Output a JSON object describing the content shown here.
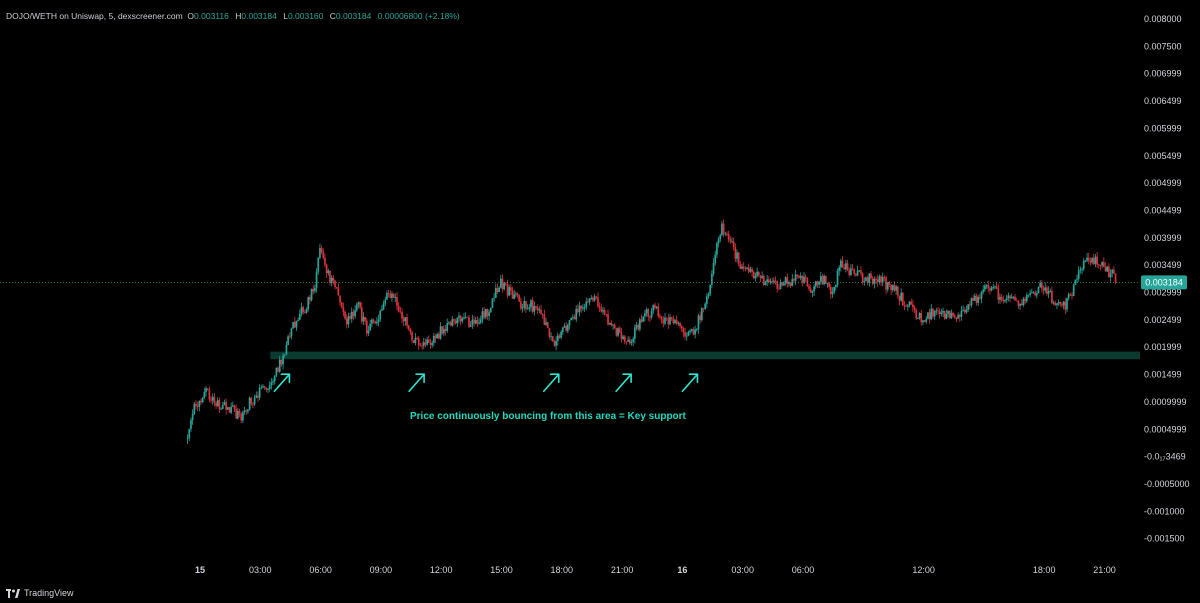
{
  "legend": {
    "symbol": "DOJO/WETH on Uniswap, 5, dexscreener.com",
    "open_label": "O",
    "open": "0.003116",
    "high_label": "H",
    "high": "0.003184",
    "low_label": "L",
    "low": "0.003160",
    "close_label": "C",
    "close": "0.003184",
    "change": "0.00006800 (+2.18%)"
  },
  "price_tag": "0.003184",
  "brand": "TradingView",
  "annotation": "Price continuously bouncing from this area = Key support",
  "colors": {
    "background": "#000000",
    "up": "#26a69a",
    "down": "#e0313b",
    "support_zone": "#0b3a30",
    "price_tag_bg": "#26a69a",
    "annotation": "#21d9c0",
    "arrow": "#2ee6cf"
  },
  "chart_data": {
    "type": "candlestick",
    "y_tick_labels": [
      "0.008000",
      "0.007500",
      "0.006999",
      "0.006499",
      "0.005999",
      "0.005499",
      "0.004999",
      "0.004499",
      "0.003999",
      "0.003499",
      "0.002999",
      "0.002499",
      "0.001999",
      "0.001499",
      "0.0009999",
      "0.0004999",
      "-0.0₁₇3469",
      "-0.0005000",
      "-0.001000",
      "-0.001500"
    ],
    "y_tick_values": [
      0.008,
      0.0075,
      0.007,
      0.0065,
      0.006,
      0.0055,
      0.005,
      0.0045,
      0.004,
      0.0035,
      0.003,
      0.0025,
      0.002,
      0.0015,
      0.001,
      0.0005,
      0.0,
      -0.0005,
      -0.001,
      -0.0015
    ],
    "ylim": [
      -0.0019,
      0.0081
    ],
    "x_tick_labels": [
      "15",
      "03:00",
      "06:00",
      "09:00",
      "12:00",
      "15:00",
      "18:00",
      "21:00",
      "16",
      "03:00",
      "06:00",
      "12:00",
      "18:00",
      "21:00"
    ],
    "x_tick_hours": [
      0,
      3,
      6,
      9,
      12,
      15,
      18,
      21,
      24,
      27,
      30,
      36,
      42,
      45
    ],
    "bold_x_ticks": [
      "15",
      "16"
    ],
    "time_range_hours": [
      -1.3,
      47.0
    ],
    "current_price": 0.003184,
    "support_zone": [
      0.00178,
      0.00192
    ],
    "support_zone_hours": [
      3.5,
      47.0
    ],
    "bounce_points_hours": [
      4.2,
      10.9,
      17.6,
      21.2,
      24.5
    ],
    "price_path": [
      [
        -0.7,
        0.00032
      ],
      [
        -0.3,
        0.00085
      ],
      [
        0.3,
        0.00115
      ],
      [
        0.7,
        0.001
      ],
      [
        1.5,
        0.0009
      ],
      [
        2.0,
        0.0007
      ],
      [
        2.6,
        0.00105
      ],
      [
        3.3,
        0.00125
      ],
      [
        3.8,
        0.0016
      ],
      [
        4.2,
        0.0019
      ],
      [
        4.6,
        0.0024
      ],
      [
        5.2,
        0.0027
      ],
      [
        5.7,
        0.0031
      ],
      [
        6.0,
        0.0038
      ],
      [
        6.4,
        0.0033
      ],
      [
        6.8,
        0.003
      ],
      [
        7.3,
        0.0024
      ],
      [
        7.8,
        0.0028
      ],
      [
        8.3,
        0.0023
      ],
      [
        8.8,
        0.0025
      ],
      [
        9.3,
        0.003
      ],
      [
        9.8,
        0.0028
      ],
      [
        10.4,
        0.0023
      ],
      [
        10.9,
        0.002
      ],
      [
        11.5,
        0.0021
      ],
      [
        12.0,
        0.0023
      ],
      [
        12.6,
        0.0025
      ],
      [
        13.2,
        0.00245
      ],
      [
        13.8,
        0.0025
      ],
      [
        14.4,
        0.0027
      ],
      [
        14.9,
        0.0032
      ],
      [
        15.4,
        0.003
      ],
      [
        15.9,
        0.0028
      ],
      [
        16.4,
        0.0028
      ],
      [
        16.9,
        0.0026
      ],
      [
        17.6,
        0.0021
      ],
      [
        18.1,
        0.0023
      ],
      [
        18.6,
        0.00255
      ],
      [
        19.1,
        0.00275
      ],
      [
        19.7,
        0.0029
      ],
      [
        20.2,
        0.0025
      ],
      [
        20.7,
        0.0023
      ],
      [
        21.2,
        0.002
      ],
      [
        21.7,
        0.0023
      ],
      [
        22.2,
        0.0026
      ],
      [
        22.7,
        0.0027
      ],
      [
        23.2,
        0.00245
      ],
      [
        23.7,
        0.0025
      ],
      [
        24.2,
        0.00215
      ],
      [
        24.7,
        0.0024
      ],
      [
        25.2,
        0.00285
      ],
      [
        25.6,
        0.0037
      ],
      [
        26.0,
        0.0042
      ],
      [
        26.4,
        0.0039
      ],
      [
        26.9,
        0.0035
      ],
      [
        27.4,
        0.0034
      ],
      [
        27.9,
        0.0033
      ],
      [
        28.4,
        0.0031
      ],
      [
        28.9,
        0.00315
      ],
      [
        29.4,
        0.0032
      ],
      [
        29.9,
        0.00325
      ],
      [
        30.4,
        0.0031
      ],
      [
        30.9,
        0.0033
      ],
      [
        31.4,
        0.003
      ],
      [
        31.9,
        0.0035
      ],
      [
        32.4,
        0.0034
      ],
      [
        32.9,
        0.0033
      ],
      [
        33.4,
        0.00325
      ],
      [
        33.9,
        0.0032
      ],
      [
        34.4,
        0.0031
      ],
      [
        34.9,
        0.0029
      ],
      [
        35.4,
        0.0027
      ],
      [
        35.9,
        0.00255
      ],
      [
        36.4,
        0.0026
      ],
      [
        36.9,
        0.00265
      ],
      [
        37.4,
        0.00255
      ],
      [
        37.9,
        0.00265
      ],
      [
        38.4,
        0.0028
      ],
      [
        38.9,
        0.003
      ],
      [
        39.4,
        0.0031
      ],
      [
        39.9,
        0.0029
      ],
      [
        40.4,
        0.00295
      ],
      [
        40.9,
        0.0028
      ],
      [
        41.4,
        0.003
      ],
      [
        41.9,
        0.0031
      ],
      [
        42.4,
        0.0029
      ],
      [
        42.9,
        0.0027
      ],
      [
        43.4,
        0.003
      ],
      [
        43.9,
        0.0035
      ],
      [
        44.4,
        0.0036
      ],
      [
        44.9,
        0.0035
      ],
      [
        45.4,
        0.0033
      ],
      [
        45.6,
        0.00318
      ]
    ]
  }
}
